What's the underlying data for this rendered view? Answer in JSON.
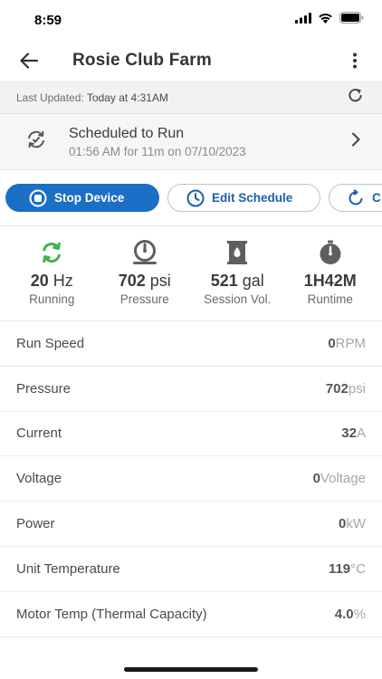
{
  "status_bar": {
    "time": "8:59"
  },
  "header": {
    "title": "Rosie Club Farm",
    "back_icon": "arrow-left-icon",
    "menu_icon": "more-vertical-icon"
  },
  "updated": {
    "label": "Last Updated:",
    "value": "Today at 4:31AM",
    "refresh_icon": "refresh-icon"
  },
  "schedule": {
    "title": "Scheduled to Run",
    "subtitle": "01:56 AM for 11m on 07/10/2023",
    "icon": "sync-icon"
  },
  "actions": [
    {
      "label": "Stop Device",
      "icon": "stop-icon",
      "style": "primary"
    },
    {
      "label": "Edit Schedule",
      "icon": "clock-icon",
      "style": "outline"
    },
    {
      "label": "C",
      "icon": "cycle-icon",
      "style": "outline"
    }
  ],
  "stats": [
    {
      "value": "20",
      "unit": "Hz",
      "label": "Running",
      "icon": "running-icon",
      "color": "#3db34a"
    },
    {
      "value": "702",
      "unit": "psi",
      "label": "Pressure",
      "icon": "gauge-icon",
      "color": "#5f5f5f"
    },
    {
      "value": "521",
      "unit": "gal",
      "label": "Session Vol.",
      "icon": "tank-icon",
      "color": "#5f5f5f"
    },
    {
      "value": "1H42M",
      "unit": "",
      "label": "Runtime",
      "icon": "timer-icon",
      "color": "#5f5f5f"
    }
  ],
  "metrics": [
    {
      "label": "Run Speed",
      "value": "0",
      "unit": "RPM"
    },
    {
      "label": "Pressure",
      "value": "702",
      "unit": "psi"
    },
    {
      "label": "Current",
      "value": "32",
      "unit": "A"
    },
    {
      "label": "Voltage",
      "value": "0",
      "unit": "Voltage"
    },
    {
      "label": "Power",
      "value": "0",
      "unit": "kW"
    },
    {
      "label": "Unit Temperature",
      "value": "119",
      "unit": "°C"
    },
    {
      "label": "Motor Temp (Thermal Capacity)",
      "value": "4.0",
      "unit": "%"
    }
  ]
}
